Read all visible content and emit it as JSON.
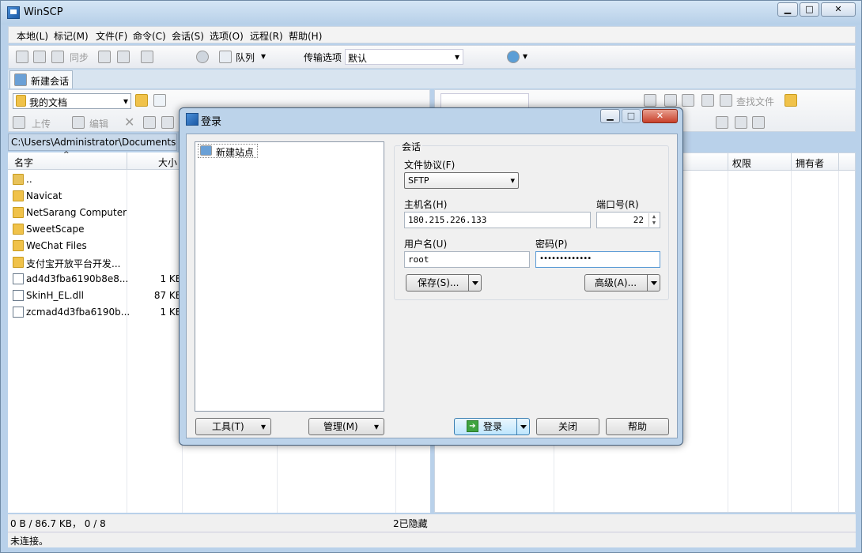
{
  "app": {
    "title": "WinSCP"
  },
  "menu": [
    "本地(L)",
    "标记(M)",
    "文件(F)",
    "命令(C)",
    "会话(S)",
    "选项(O)",
    "远程(R)",
    "帮助(H)"
  ],
  "toolbar": {
    "sync": "同步",
    "queue": "队列",
    "transfer_label": "传输选项",
    "transfer_value": "默认"
  },
  "tab": {
    "label": "新建会话"
  },
  "left_panel": {
    "location": "我的文档",
    "upload": "上传",
    "edit": "编辑",
    "path": "C:\\Users\\Administrator\\Documents\\",
    "col_name": "名字",
    "col_size": "大小",
    "files": [
      {
        "name": "..",
        "size": "",
        "type": "up"
      },
      {
        "name": "Navicat",
        "size": "",
        "type": "folder"
      },
      {
        "name": "NetSarang Computer",
        "size": "",
        "type": "folder"
      },
      {
        "name": "SweetScape",
        "size": "",
        "type": "folder"
      },
      {
        "name": "WeChat Files",
        "size": "",
        "type": "folder"
      },
      {
        "name": "支付宝开放平台开发...",
        "size": "",
        "type": "folder"
      },
      {
        "name": "ad4d3fba6190b8e8...",
        "size": "1 KB",
        "type": "file"
      },
      {
        "name": "SkinH_EL.dll",
        "size": "87 KB",
        "type": "file"
      },
      {
        "name": "zcmad4d3fba6190b...",
        "size": "1 KB",
        "type": "file"
      }
    ]
  },
  "right_panel": {
    "find": "查找文件",
    "col_perm": "权限",
    "col_owner": "拥有者"
  },
  "status": {
    "left": "0 B / 86.7 KB， 0 / 8",
    "hidden": "2已隐藏",
    "conn": "未连接。"
  },
  "dialog": {
    "title": "登录",
    "tree_item": "新建站点",
    "session_group": "会话",
    "protocol_label": "文件协议(F)",
    "protocol_value": "SFTP",
    "host_label": "主机名(H)",
    "host_value": "180.215.226.133",
    "port_label": "端口号(R)",
    "port_value": "22",
    "user_label": "用户名(U)",
    "user_value": "root",
    "pass_label": "密码(P)",
    "pass_value": "•••••••••••••",
    "save": "保存(S)...",
    "advanced": "高级(A)...",
    "tools": "工具(T)",
    "manage": "管理(M)",
    "login": "登录",
    "close": "关闭",
    "help": "帮助"
  }
}
